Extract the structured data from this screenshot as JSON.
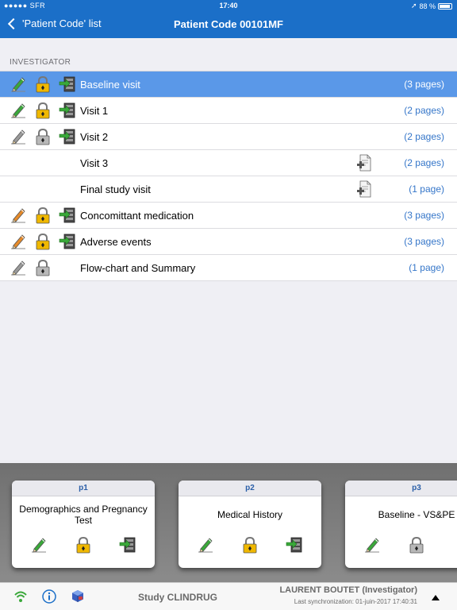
{
  "status_bar": {
    "carrier": "●●●●● SFR ",
    "time": "17:40",
    "battery": "88 %"
  },
  "nav": {
    "back_label": "'Patient Code' list",
    "title": "Patient Code 00101MF"
  },
  "section": {
    "header": "INVESTIGATOR"
  },
  "visits": [
    {
      "label": "Baseline visit",
      "pages": "(3 pages)",
      "pencil": "green",
      "lock": "yellow",
      "transfer": true,
      "add_doc": false,
      "selected": true
    },
    {
      "label": "Visit 1",
      "pages": "(2 pages)",
      "pencil": "green",
      "lock": "yellow",
      "transfer": true,
      "add_doc": false,
      "selected": false
    },
    {
      "label": "Visit 2",
      "pages": "(2 pages)",
      "pencil": "gray",
      "lock": "gray",
      "transfer": true,
      "add_doc": false,
      "selected": false
    },
    {
      "label": "Visit 3",
      "pages": "(2 pages)",
      "pencil": null,
      "lock": null,
      "transfer": false,
      "add_doc": true,
      "selected": false
    },
    {
      "label": "Final study visit",
      "pages": "(1 page)",
      "pencil": null,
      "lock": null,
      "transfer": false,
      "add_doc": true,
      "selected": false
    },
    {
      "label": "Concomittant medication",
      "pages": "(3 pages)",
      "pencil": "orange",
      "lock": "yellow",
      "transfer": true,
      "add_doc": false,
      "selected": false
    },
    {
      "label": "Adverse events",
      "pages": "(3 pages)",
      "pencil": "orange",
      "lock": "yellow",
      "transfer": true,
      "add_doc": false,
      "selected": false
    },
    {
      "label": "Flow-chart and Summary",
      "pages": "(1 page)",
      "pencil": "gray",
      "lock": "gray",
      "transfer": false,
      "add_doc": false,
      "selected": false
    }
  ],
  "page_cards": [
    {
      "title": "p1",
      "name": "Demographics and Pregnancy Test",
      "pencil": "green",
      "lock": "yellow",
      "transfer": true
    },
    {
      "title": "p2",
      "name": "Medical History",
      "pencil": "green",
      "lock": "yellow",
      "transfer": true
    },
    {
      "title": "p3",
      "name": "Baseline - VS&PE",
      "pencil": "green",
      "lock": "gray",
      "transfer": false
    }
  ],
  "footer": {
    "study": "Study CLINDRUG",
    "user": "LAURENT BOUTET (Investigator)",
    "sync": "Last synchronization: 01-juin-2017 17:40:31"
  },
  "colors": {
    "nav_bar": "#1b6fc8",
    "selected_row": "#5a98e8",
    "link_text": "#3576c9",
    "pencil_green": "#3aa83a",
    "pencil_orange": "#e58a2a",
    "pencil_gray": "#9a9a9a",
    "lock_yellow": "#f0b800",
    "lock_gray": "#b8b8b8"
  }
}
